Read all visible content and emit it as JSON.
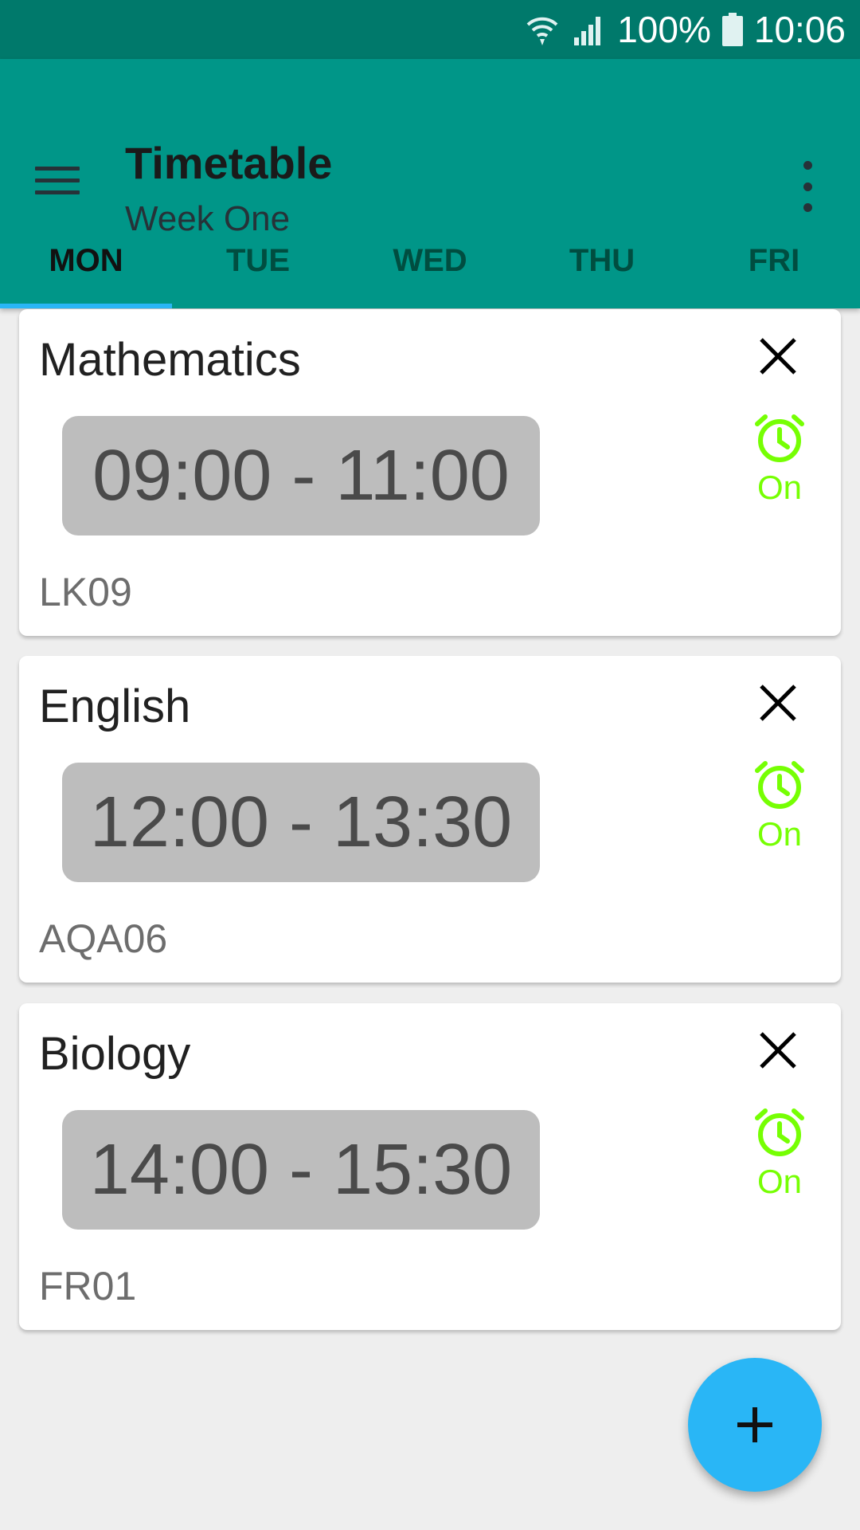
{
  "status_bar": {
    "battery_percent": "100%",
    "time": "10:06",
    "icons": [
      "wifi-icon",
      "signal-icon",
      "battery-icon"
    ]
  },
  "app_bar": {
    "title": "Timetable",
    "subtitle": "Week One",
    "menu_icon": "menu-icon",
    "overflow_icon": "overflow-menu-icon"
  },
  "tabs": [
    {
      "label": "MON",
      "selected": true
    },
    {
      "label": "TUE",
      "selected": false
    },
    {
      "label": "WED",
      "selected": false
    },
    {
      "label": "THU",
      "selected": false
    },
    {
      "label": "FRI",
      "selected": false
    }
  ],
  "lessons": [
    {
      "subject": "Mathematics",
      "time": "09:00 - 11:00",
      "room": "LK09",
      "alarm": "On"
    },
    {
      "subject": "English",
      "time": "12:00 - 13:30",
      "room": "AQA06",
      "alarm": "On"
    },
    {
      "subject": "Biology",
      "time": "14:00 - 15:30",
      "room": "FR01",
      "alarm": "On"
    }
  ],
  "fab": {
    "icon": "plus-icon"
  },
  "colors": {
    "status_bar": "#00796b",
    "app_bar": "#009688",
    "tab_indicator": "#29b6f6",
    "alarm_on": "#76ff03",
    "fab": "#29b6f6",
    "time_chip": "#bdbdbd"
  }
}
